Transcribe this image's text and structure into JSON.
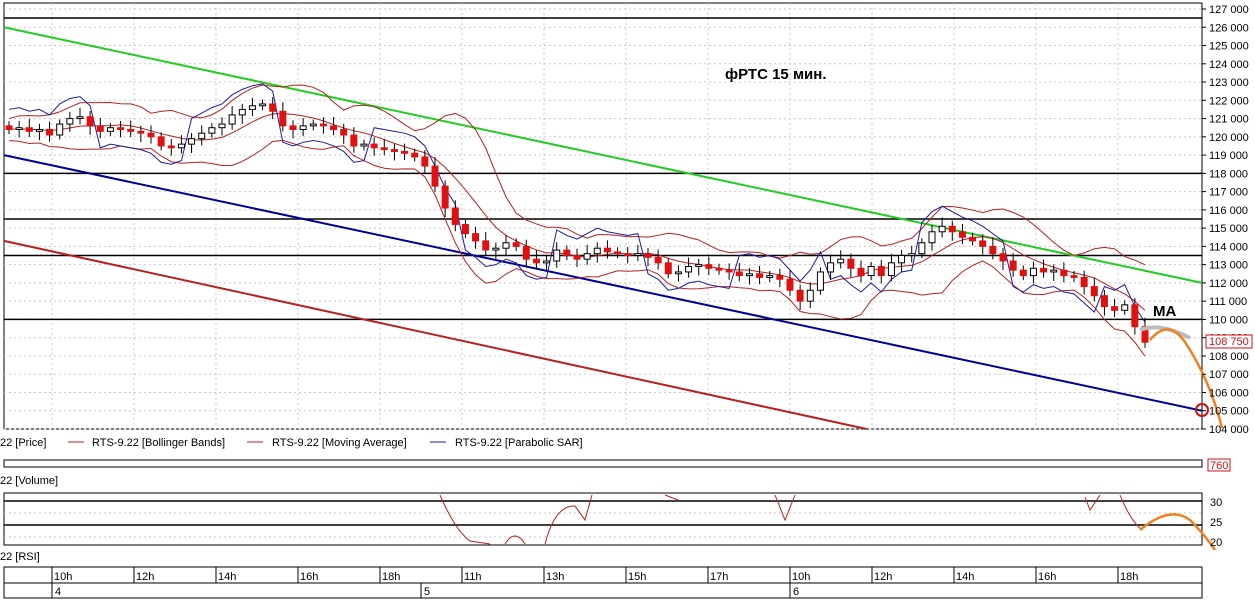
{
  "chart_data": {
    "type": "candlestick",
    "title": "фРТС   15 мин.",
    "symbol": "RTS-9.22",
    "price_axis": {
      "min": 104000,
      "max": 127000,
      "step": 1000,
      "ticks": [
        "104 000",
        "105 000",
        "106 000",
        "107 000",
        "108 000",
        "109 000",
        "110 000",
        "111 000",
        "112 000",
        "113 000",
        "114 000",
        "115 000",
        "116 000",
        "117 000",
        "118 000",
        "119 000",
        "120 000",
        "121 000",
        "122 000",
        "123 000",
        "124 000",
        "125 000",
        "126 000",
        "127 000"
      ]
    },
    "last_price_label": "108 750",
    "last_price": 108750,
    "volume_label": "760",
    "rsi_axis": {
      "ticks": [
        "30",
        "25",
        "20"
      ]
    },
    "time_axis": {
      "hours": [
        "10h",
        "12h",
        "14h",
        "16h",
        "18h",
        "11h",
        "13h",
        "15h",
        "17h",
        "10h",
        "12h",
        "14h",
        "16h",
        "18h"
      ],
      "days": [
        "4",
        "5",
        "6"
      ]
    },
    "legend": [
      {
        "label": "22 [Price]",
        "color": "#ffffff"
      },
      {
        "label": "RTS-9.22 [Bollinger Bands]",
        "color": "#b22222"
      },
      {
        "label": "RTS-9.22 [Moving Average]",
        "color": "#b22222"
      },
      {
        "label": "RTS-9.22 [Parabolic SAR]",
        "color": "#1a1aa0"
      }
    ],
    "panel_labels": {
      "volume": "22 [Volume]",
      "rsi": "22 [RSI]"
    },
    "annotation_ma": "MA",
    "horizontal_levels": [
      118000,
      115500,
      113500,
      110000
    ],
    "trendlines": [
      {
        "color": "#22cc22",
        "from": [
          0,
          126000
        ],
        "to": [
          1,
          112000
        ]
      },
      {
        "color": "#000099",
        "from": [
          0,
          119000
        ],
        "to": [
          1,
          105000
        ]
      },
      {
        "color": "#b82020",
        "from": [
          0,
          114300
        ],
        "to": [
          0.72,
          104000
        ]
      }
    ],
    "closes": [
      120400,
      120500,
      120300,
      120400,
      120100,
      120700,
      121000,
      121100,
      120600,
      120300,
      120500,
      120400,
      120300,
      120200,
      120000,
      119500,
      119400,
      119600,
      119900,
      120200,
      120500,
      120700,
      121200,
      121500,
      121700,
      121800,
      121400,
      120600,
      120400,
      120600,
      120700,
      120600,
      120400,
      120100,
      119500,
      119600,
      119400,
      119300,
      119200,
      119100,
      118900,
      118400,
      117300,
      116100,
      115200,
      114700,
      114300,
      113800,
      113900,
      114200,
      114000,
      113300,
      113100,
      113200,
      113800,
      113500,
      113300,
      113600,
      113900,
      113700,
      113600,
      113500,
      113600,
      113400,
      113100,
      112500,
      112600,
      112900,
      113000,
      112800,
      112700,
      112600,
      112400,
      112500,
      112300,
      112400,
      112200,
      111600,
      111000,
      111600,
      112600,
      113100,
      113300,
      112800,
      112400,
      112900,
      112400,
      113100,
      113500,
      113600,
      114200,
      114800,
      115100,
      114800,
      114500,
      114300,
      114000,
      113600,
      113200,
      112700,
      112400,
      112800,
      112600,
      112700,
      112400,
      112300,
      111800,
      111300,
      110700,
      110500,
      110800,
      109600,
      108750
    ]
  }
}
